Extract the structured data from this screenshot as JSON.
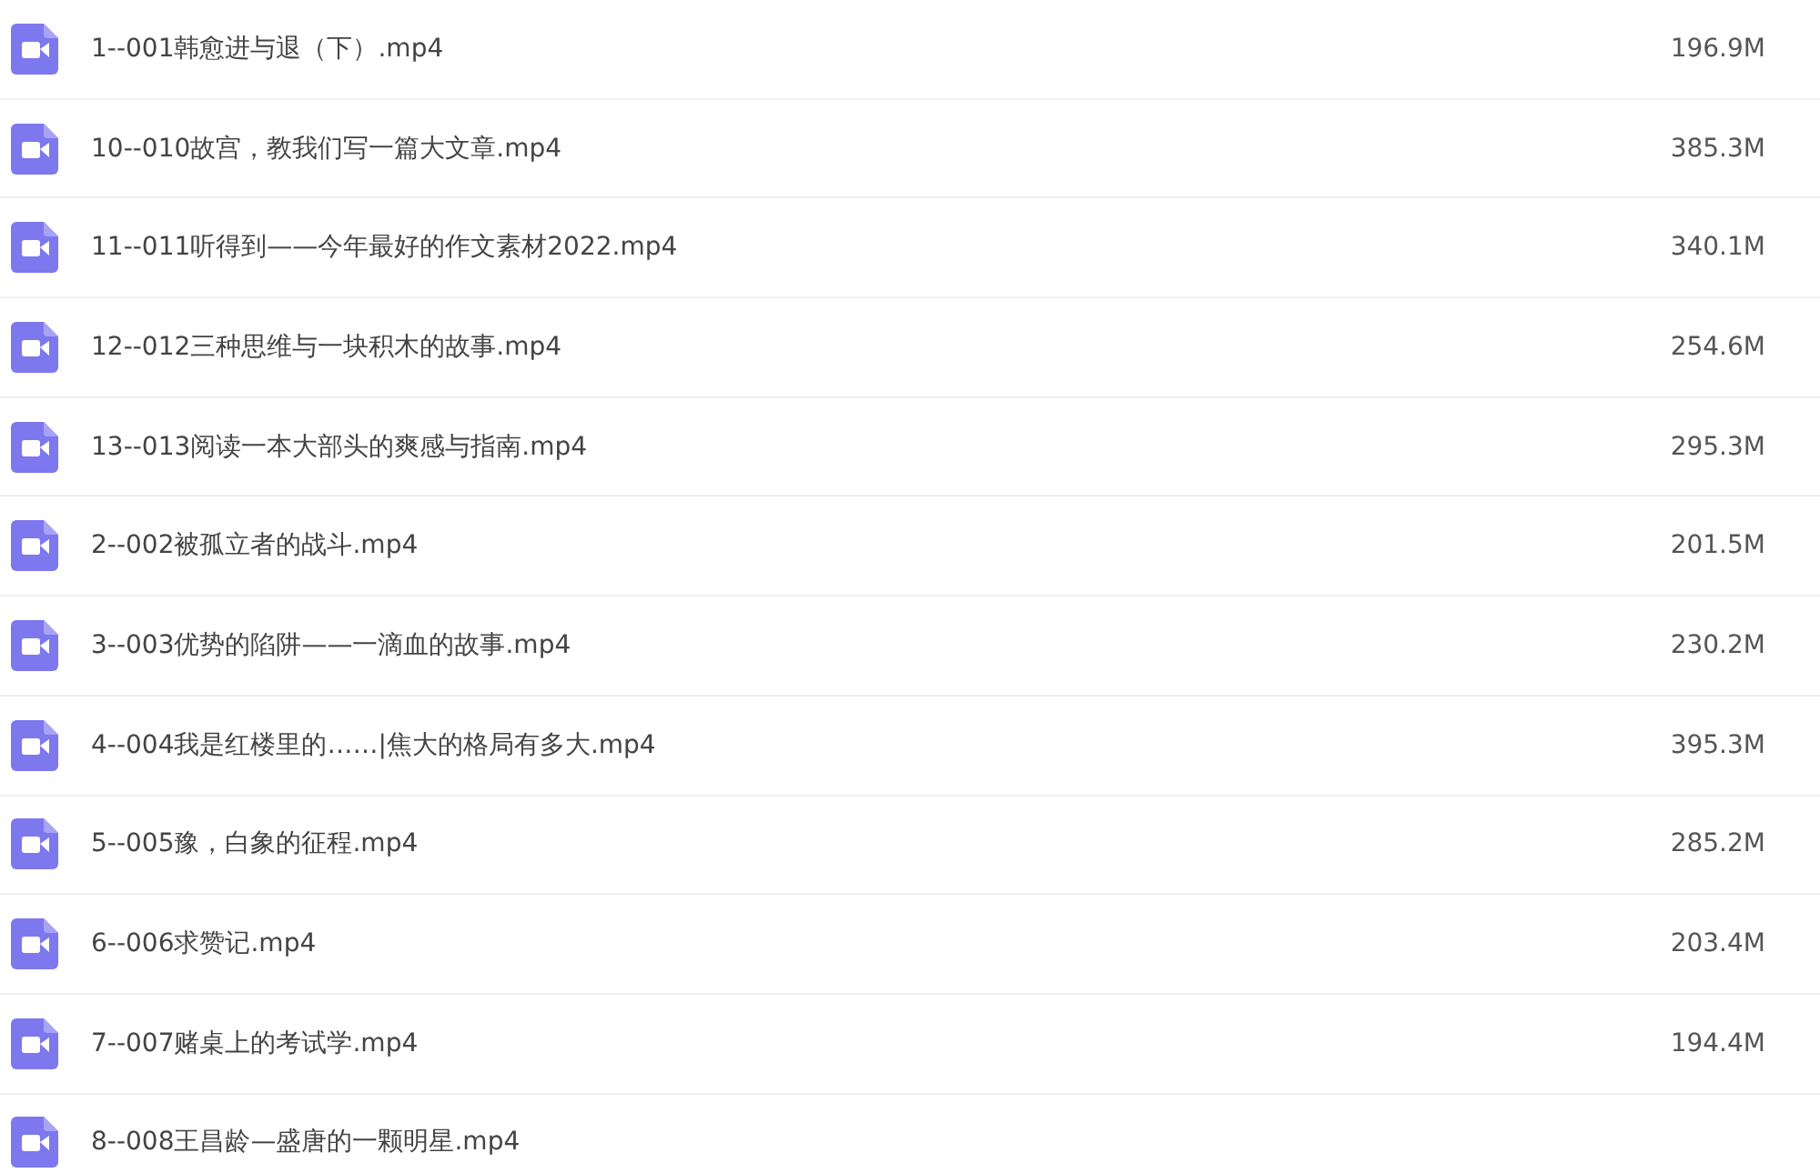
{
  "files": [
    {
      "name": "1--001韩愈进与退（下）.mp4",
      "size": "196.9M"
    },
    {
      "name": "10--010故宫，教我们写一篇大文章.mp4",
      "size": "385.3M"
    },
    {
      "name": "11--011听得到——今年最好的作文素材2022.mp4",
      "size": "340.1M"
    },
    {
      "name": "12--012三种思维与一块积木的故事.mp4",
      "size": "254.6M"
    },
    {
      "name": "13--013阅读一本大部头的爽感与指南.mp4",
      "size": "295.3M"
    },
    {
      "name": "2--002被孤立者的战斗.mp4",
      "size": "201.5M"
    },
    {
      "name": "3--003优势的陷阱——一滴血的故事.mp4",
      "size": "230.2M"
    },
    {
      "name": "4--004我是红楼里的……|焦大的格局有多大.mp4",
      "size": "395.3M"
    },
    {
      "name": "5--005豫，白象的征程.mp4",
      "size": "285.2M"
    },
    {
      "name": "6--006求赞记.mp4",
      "size": "203.4M"
    },
    {
      "name": "7--007赌桌上的考试学.mp4",
      "size": "194.4M"
    },
    {
      "name": "8--008王昌龄—盛唐的一颗明星.mp4"
    }
  ]
}
